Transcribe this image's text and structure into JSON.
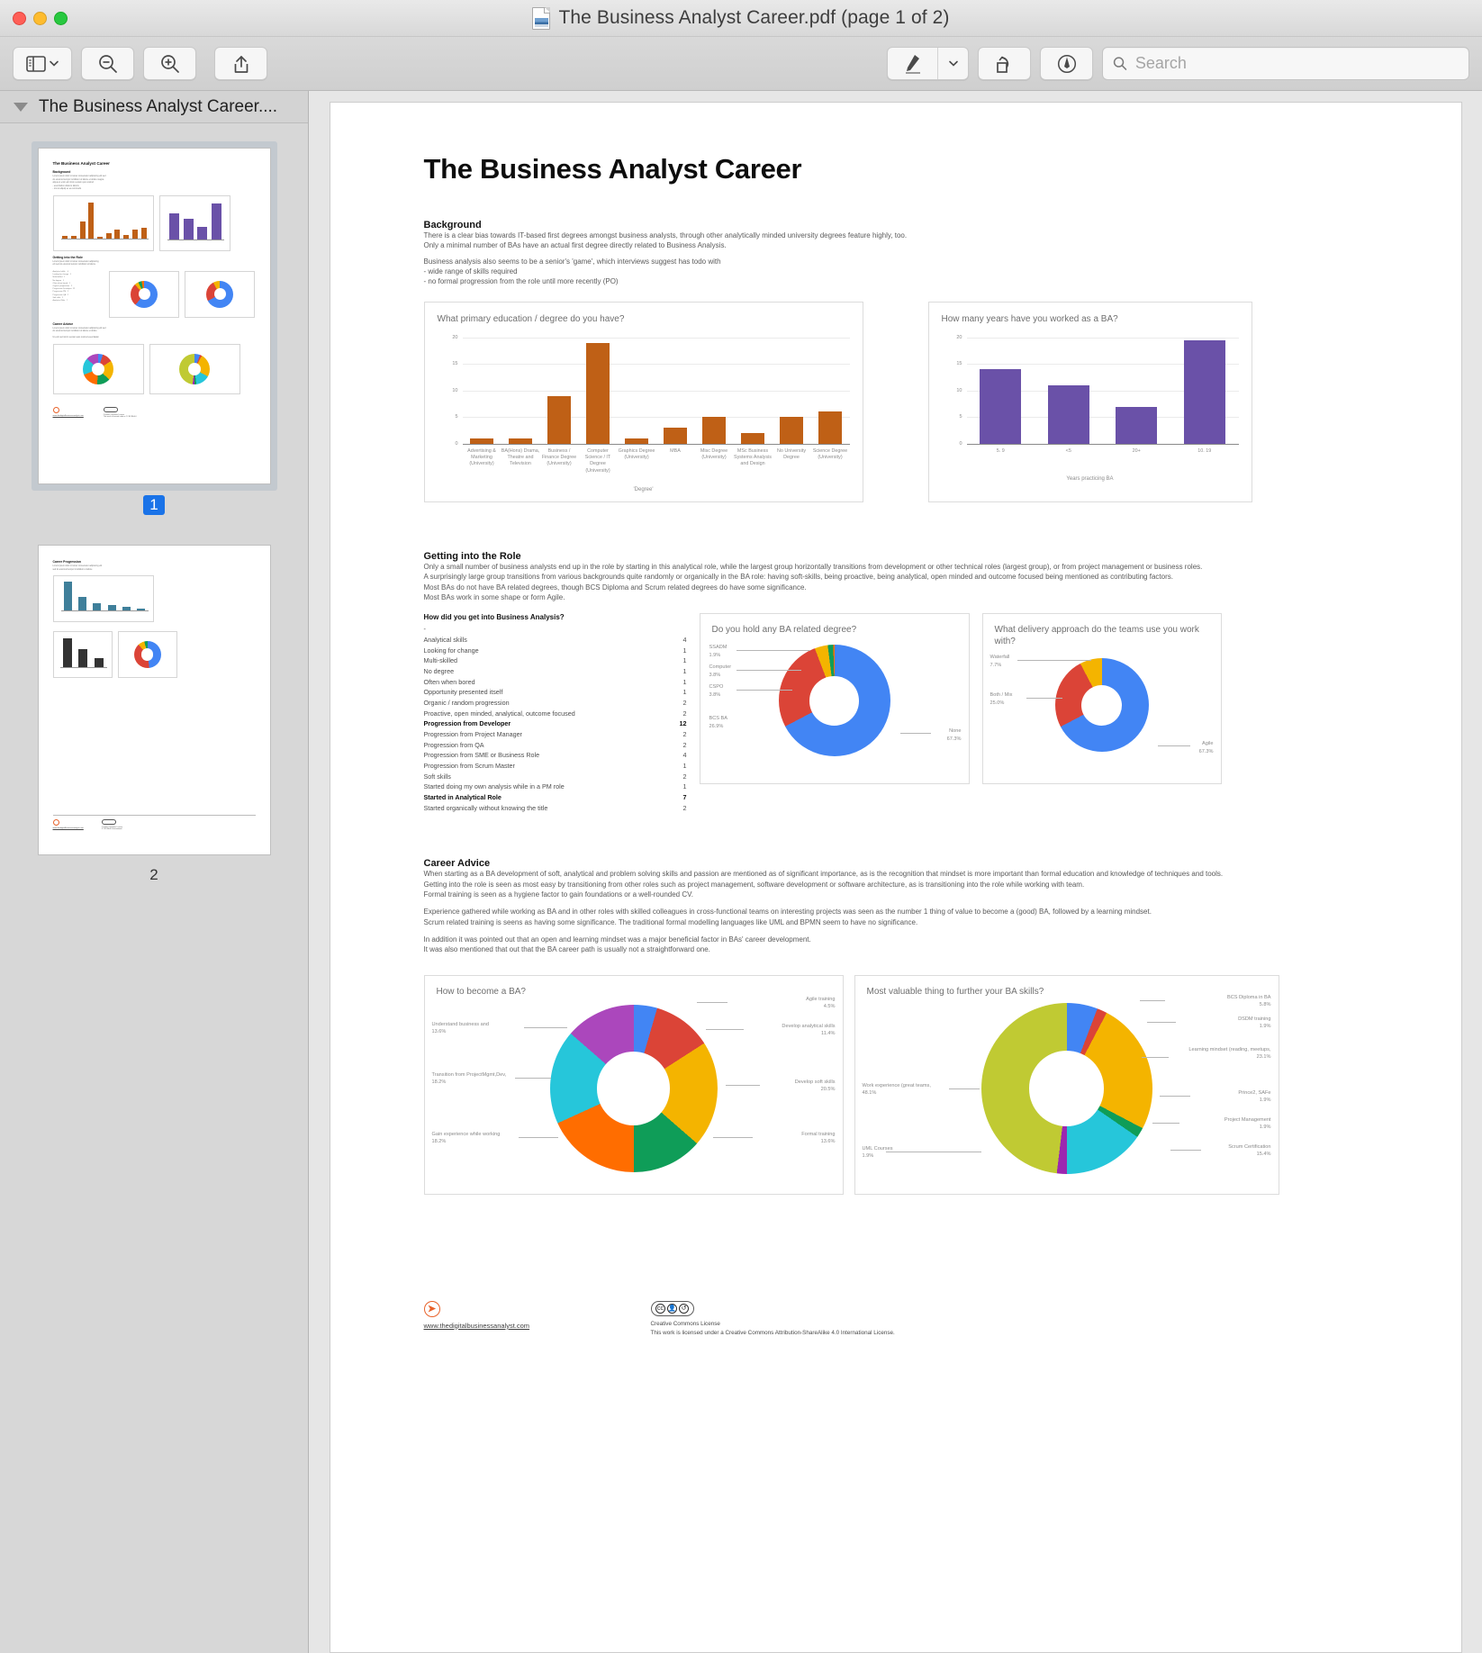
{
  "window": {
    "title": "The Business Analyst Career.pdf (page 1 of 2)",
    "file_icon": "pdf-document-icon"
  },
  "toolbar": {
    "sidebar_button": "sidebar-view-icon",
    "sidebar_chevron": "chevron-down-icon",
    "zoom_out": "zoom-out-icon",
    "zoom_in": "zoom-in-icon",
    "share": "share-icon",
    "markup": "markup-pen-icon",
    "markup_chevron": "chevron-down-icon",
    "rotate": "rotate-left-icon",
    "annotate": "annotate-icon",
    "search_placeholder": "Search",
    "search_value": "",
    "search_icon": "search-icon"
  },
  "sidebar": {
    "header_title": "The Business Analyst Career....",
    "disclosure": "disclosure-triangle-icon",
    "thumbnails": [
      {
        "page_label": "1",
        "selected": true
      },
      {
        "page_label": "2",
        "selected": false
      }
    ]
  },
  "document": {
    "title": "The Business Analyst Career",
    "sections": [
      {
        "heading": "Background",
        "paragraphs": [
          "There is a clear bias towards IT-based first degrees amongst business analysts, through other analytically minded university degrees feature highly, too.",
          "Only a minimal number of BAs have an actual first degree directly related to Business Analysis.",
          "Business analysis also seems to be a senior's 'game', which interviews suggest has todo with",
          "- wide range of skills required",
          "- no formal progression from the role until more recently (PO)"
        ]
      },
      {
        "heading": "Getting into the Role",
        "paragraphs": [
          "Only a small number of business analysts end up in the role by starting in this analytical role, while the largest group horizontally transitions from development or other technical roles (largest group), or from project management or business roles.",
          "A surprisingly large group transitions from various backgrounds quite randomly or organically in the BA role: having soft-skills, being proactive, being analytical, open minded and outcome focused being mentioned as contributing factors.",
          "Most BAs do not have BA related degrees, though BCS Diploma and Scrum related degrees do have some significance.",
          "Most BAs work in some shape or form Agile."
        ]
      },
      {
        "heading": "Career Advice",
        "paragraphs": [
          "When starting as a BA development of soft, analytical and problem solving skills and passion are mentioned as of significant importance, as is the recognition that mindset is more important than formal education and knowledge of techniques and tools.",
          "Getting into the role is seen as most easy by transitioning from other roles such as project management, software development or software architecture, as is transitioning into the role while working with team.",
          "Formal training is seen as a hygiene factor to gain foundations or a well-rounded CV.",
          "Experience gathered while working as BA and in other roles with skilled colleagues in cross-functional teams on interesting projects was seen as the number 1 thing of value to become a (good) BA, followed by a learning mindset.",
          "Scrum related training is seens as having some significance. The traditional formal modelling languages like UML and BPMN seem to have no significance.",
          "In addition it was pointed out that an open and learning mindset was a major beneficial factor in BAs' career development.",
          "It was also mentioned that out that the BA career path is usually not a straightforward one."
        ]
      }
    ],
    "list": {
      "heading": "How did you get into Business Analysis?",
      "rows": [
        {
          "label": "-",
          "value": "",
          "bold": false
        },
        {
          "label": "Analytical skills",
          "value": "4",
          "bold": false
        },
        {
          "label": "Looking for change",
          "value": "1",
          "bold": false
        },
        {
          "label": "Multi-skilled",
          "value": "1",
          "bold": false
        },
        {
          "label": "No degree",
          "value": "1",
          "bold": false
        },
        {
          "label": "Often when bored",
          "value": "1",
          "bold": false
        },
        {
          "label": "Opportunity presented itself",
          "value": "1",
          "bold": false
        },
        {
          "label": "Organic / random progression",
          "value": "2",
          "bold": false
        },
        {
          "label": "Proactive, open minded, analytical, outcome focused",
          "value": "2",
          "bold": false
        },
        {
          "label": "Progression from Developer",
          "value": "12",
          "bold": true
        },
        {
          "label": "Progression from Project Manager",
          "value": "2",
          "bold": false
        },
        {
          "label": "Progression from QA",
          "value": "2",
          "bold": false
        },
        {
          "label": "Progression from SME or Business Role",
          "value": "4",
          "bold": false
        },
        {
          "label": "Progression from Scrum Master",
          "value": "1",
          "bold": false
        },
        {
          "label": "Soft skills",
          "value": "2",
          "bold": false
        },
        {
          "label": "Started doing my own analysis while in a PM role",
          "value": "1",
          "bold": false
        },
        {
          "label": "Started in Analytical Role",
          "value": "7",
          "bold": true
        },
        {
          "label": "Started organically without knowing the title",
          "value": "2",
          "bold": false
        }
      ]
    },
    "footer": {
      "website": "www.thedigitalbusinessanalyst.com",
      "logo": "compass-logo-icon",
      "cc_badge": "creative-commons-icon",
      "license_title": "Creative Commons License",
      "license_text": "This work is licensed under a Creative Commons Attribution-ShareAlike 4.0 International License."
    }
  },
  "chart_data": [
    {
      "type": "bar",
      "title": "What primary education / degree do you have?",
      "xlabel": "'Degree'",
      "ylabel": "",
      "ylim": [
        0,
        20
      ],
      "yticks": [
        0,
        5,
        10,
        15,
        20
      ],
      "grid": true,
      "color": "#bf6016",
      "categories": [
        "Advertising & Marketing (University)",
        "BA(Hons) Drama, Theatre and Television",
        "Business / Finance Degree (University)",
        "Computer Science / IT Degree (University)",
        "Graphics Degree (University)",
        "MBA",
        "Misc Degree (University)",
        "MSc Business Systems Analysis and Design",
        "No University Degree",
        "Science Degree (University)"
      ],
      "values": [
        1,
        1,
        9,
        19,
        1,
        3,
        5,
        2,
        5,
        6
      ]
    },
    {
      "type": "bar",
      "title": "How many years have you worked as a BA?",
      "xlabel": "Years practicing BA",
      "ylabel": "",
      "ylim": [
        0,
        20
      ],
      "yticks": [
        0,
        5,
        10,
        15,
        20
      ],
      "grid": true,
      "color": "#6a51a8",
      "categories": [
        "5. 9",
        "<5",
        "20+",
        "10. 19"
      ],
      "values": [
        14,
        11,
        7,
        19.5
      ]
    },
    {
      "type": "pie",
      "title": "Do you hold any BA related degree?",
      "labels": [
        "None",
        "BCS BA",
        "CSPO",
        "Computer",
        "SSADM"
      ],
      "values": [
        67.3,
        26.9,
        3.8,
        3.8,
        1.9
      ],
      "value_labels": [
        "67.3%",
        "26.9%",
        "3.8%",
        "3.8%",
        "1.9%"
      ],
      "colors": [
        "#4285f4",
        "#db4437",
        "#f4b400",
        "#0f9d58",
        "#ff6d00"
      ]
    },
    {
      "type": "pie",
      "title": "What delivery approach do the teams use you work with?",
      "labels": [
        "Agile",
        "Both / Mix",
        "Waterfall"
      ],
      "values": [
        67.3,
        25.0,
        7.7
      ],
      "value_labels": [
        "67.3%",
        "25.0%",
        "7.7%"
      ],
      "colors": [
        "#4285f4",
        "#db4437",
        "#f4b400"
      ]
    },
    {
      "type": "pie",
      "title": "How to become a BA?",
      "labels": [
        "Understand business and",
        "Transition from ProjectMgmt,Dev,",
        "Gain experience while working",
        "Formal training",
        "Develop soft skills",
        "Develop analytical skills",
        "Agile training"
      ],
      "values": [
        13.6,
        18.2,
        18.2,
        13.6,
        20.5,
        11.4,
        4.5
      ],
      "value_labels": [
        "13.6%",
        "18.2%",
        "18.2%",
        "13.6%",
        "20.5%",
        "11.4%",
        "4.5%"
      ],
      "colors": [
        "#ab47bc",
        "#26c6da",
        "#ff6d00",
        "#0f9d58",
        "#f4b400",
        "#db4437",
        "#4285f4"
      ]
    },
    {
      "type": "pie",
      "title": "Most valuable thing to further your BA skills?",
      "labels": [
        "Work experience (great teams,",
        "UML Courses",
        "Scrum Certification",
        "Project Management",
        "Prince2, SAFe",
        "Learning mindset (reading, meetups,",
        "DSDM training",
        "BCS Diploma in BA"
      ],
      "values": [
        48.1,
        1.9,
        15.4,
        1.9,
        1.9,
        23.1,
        1.9,
        5.8
      ],
      "value_labels": [
        "48.1%",
        "1.9%",
        "15.4%",
        "1.9%",
        "1.9%",
        "23.1%",
        "1.9%",
        "5.8%"
      ],
      "colors": [
        "#c0ca33",
        "#9c27b0",
        "#26c6da",
        "#0f9d58",
        "#f4b400",
        "#f4b400",
        "#db4437",
        "#4285f4"
      ]
    }
  ]
}
